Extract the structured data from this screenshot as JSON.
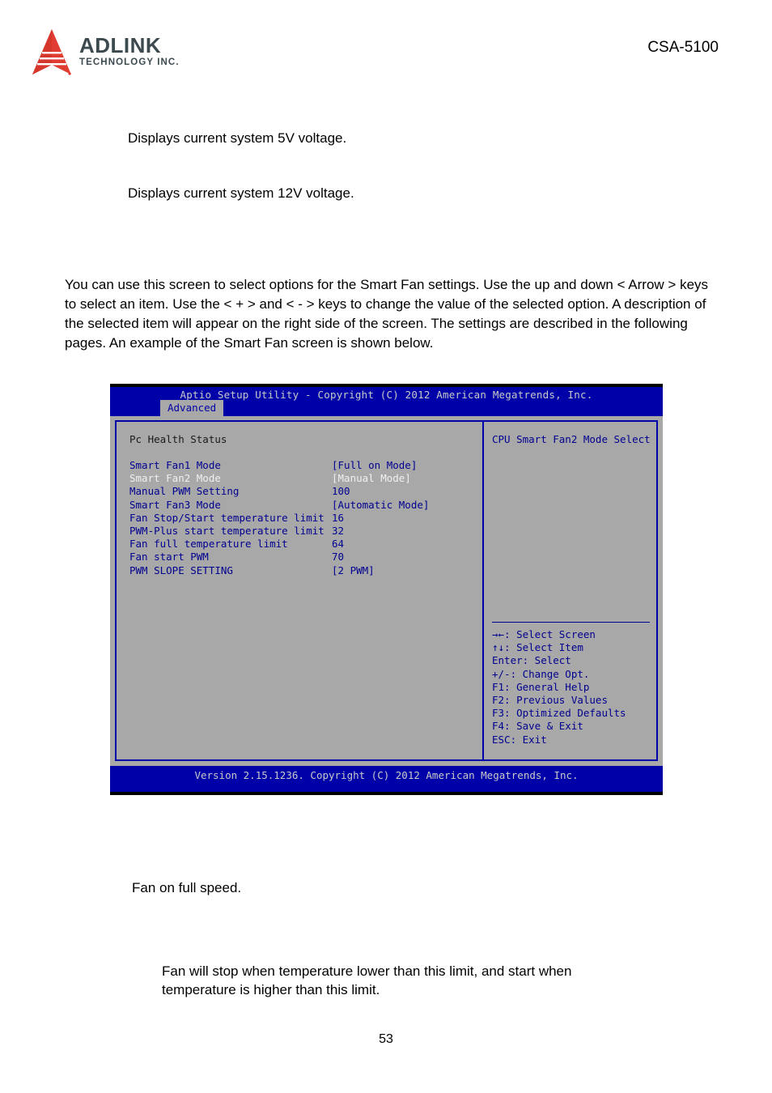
{
  "header": {
    "logo_name": "ADLINK",
    "logo_sub": "TECHNOLOGY INC.",
    "model": "CSA-5100"
  },
  "content": {
    "desc_5v": "Displays current system 5V voltage.",
    "desc_12v": "Displays current system 12V voltage.",
    "intro": "You can use this screen to select options for the Smart Fan settings. Use the up and down < Arrow > keys to select an item. Use the < + > and < - > keys to change the value of the selected option. A description of the selected item will appear on the right side of the screen. The settings are described in the following pages. An example of the Smart Fan screen is shown below.",
    "full_speed": "Fan on full speed.",
    "fan_stop_start": "Fan will stop when temperature lower than this limit, and start when temperature is higher than this limit.",
    "page_number": "53"
  },
  "bios": {
    "title": "Aptio Setup Utility - Copyright (C) 2012 American Megatrends, Inc.",
    "tab": "Advanced",
    "section_heading": "Pc Health Status",
    "rows": [
      {
        "label": "Smart Fan1 Mode",
        "value": "[Full on Mode]",
        "selected": false
      },
      {
        "label": "Smart Fan2 Mode",
        "value": "[Manual Mode]",
        "selected": true
      },
      {
        "label": "Manual PWM Setting",
        "value": "100",
        "selected": false
      },
      {
        "label": "Smart Fan3 Mode",
        "value": "[Automatic Mode]",
        "selected": false
      },
      {
        "label": "Fan Stop/Start temperature limit",
        "value": "16",
        "selected": false
      },
      {
        "label": "PWM-Plus start temperature limit",
        "value": "32",
        "selected": false
      },
      {
        "label": "Fan full temperature limit",
        "value": "64",
        "selected": false
      },
      {
        "label": "Fan start PWM",
        "value": "70",
        "selected": false
      },
      {
        "label": "PWM SLOPE SETTING",
        "value": "[2 PWM]",
        "selected": false
      }
    ],
    "help_text": "CPU Smart Fan2 Mode Select",
    "legend": [
      "→←: Select Screen",
      "↑↓: Select Item",
      "Enter: Select",
      "+/-: Change Opt.",
      "F1: General Help",
      "F2: Previous Values",
      "F3: Optimized Defaults",
      "F4: Save & Exit",
      "ESC: Exit"
    ],
    "footer": "Version 2.15.1236. Copyright (C) 2012 American Megatrends, Inc."
  },
  "colors": {
    "bios_blue": "#0000a8",
    "bios_gray": "#a8a8a8",
    "bios_text_blue": "#00008f",
    "logo_red": "#e03c31",
    "logo_dark": "#3c4a4f"
  }
}
